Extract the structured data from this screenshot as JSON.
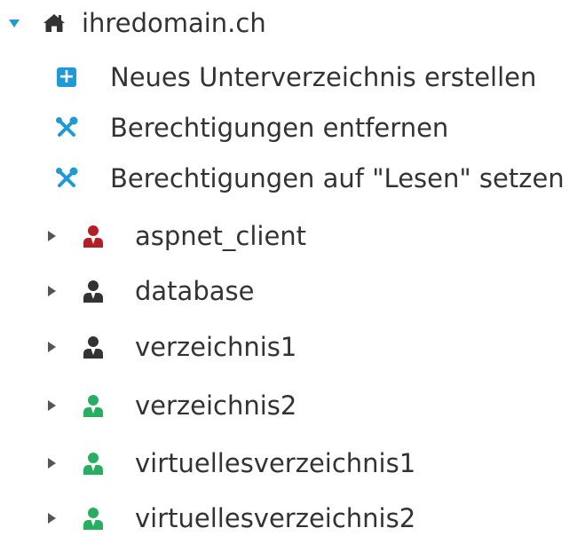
{
  "colors": {
    "accent": "#1e9ad6",
    "text": "#333333",
    "user_red": "#b41e24",
    "user_dark": "#333333",
    "user_green": "#27ae60"
  },
  "tree": {
    "root": {
      "label": "ihredomain.ch",
      "icon": "home-icon",
      "expanded": true
    },
    "actions": [
      {
        "label": "Neues Unterverzeichnis erstellen",
        "icon": "plus-box-icon"
      },
      {
        "label": "Berechtigungen entfernen",
        "icon": "tools-icon"
      },
      {
        "label": "Berechtigungen auf \"Lesen\" setzen",
        "icon": "tools-icon"
      }
    ],
    "folders": [
      {
        "label": "aspnet_client",
        "icon": "user-icon",
        "color": "#b41e24"
      },
      {
        "label": "database",
        "icon": "user-icon",
        "color": "#333333"
      },
      {
        "label": "verzeichnis1",
        "icon": "user-icon",
        "color": "#333333"
      },
      {
        "label": "verzeichnis2",
        "icon": "user-icon",
        "color": "#27ae60"
      },
      {
        "label": "virtuellesverzeichnis1",
        "icon": "user-icon",
        "color": "#27ae60"
      },
      {
        "label": "virtuellesverzeichnis2",
        "icon": "user-icon",
        "color": "#27ae60"
      }
    ]
  }
}
